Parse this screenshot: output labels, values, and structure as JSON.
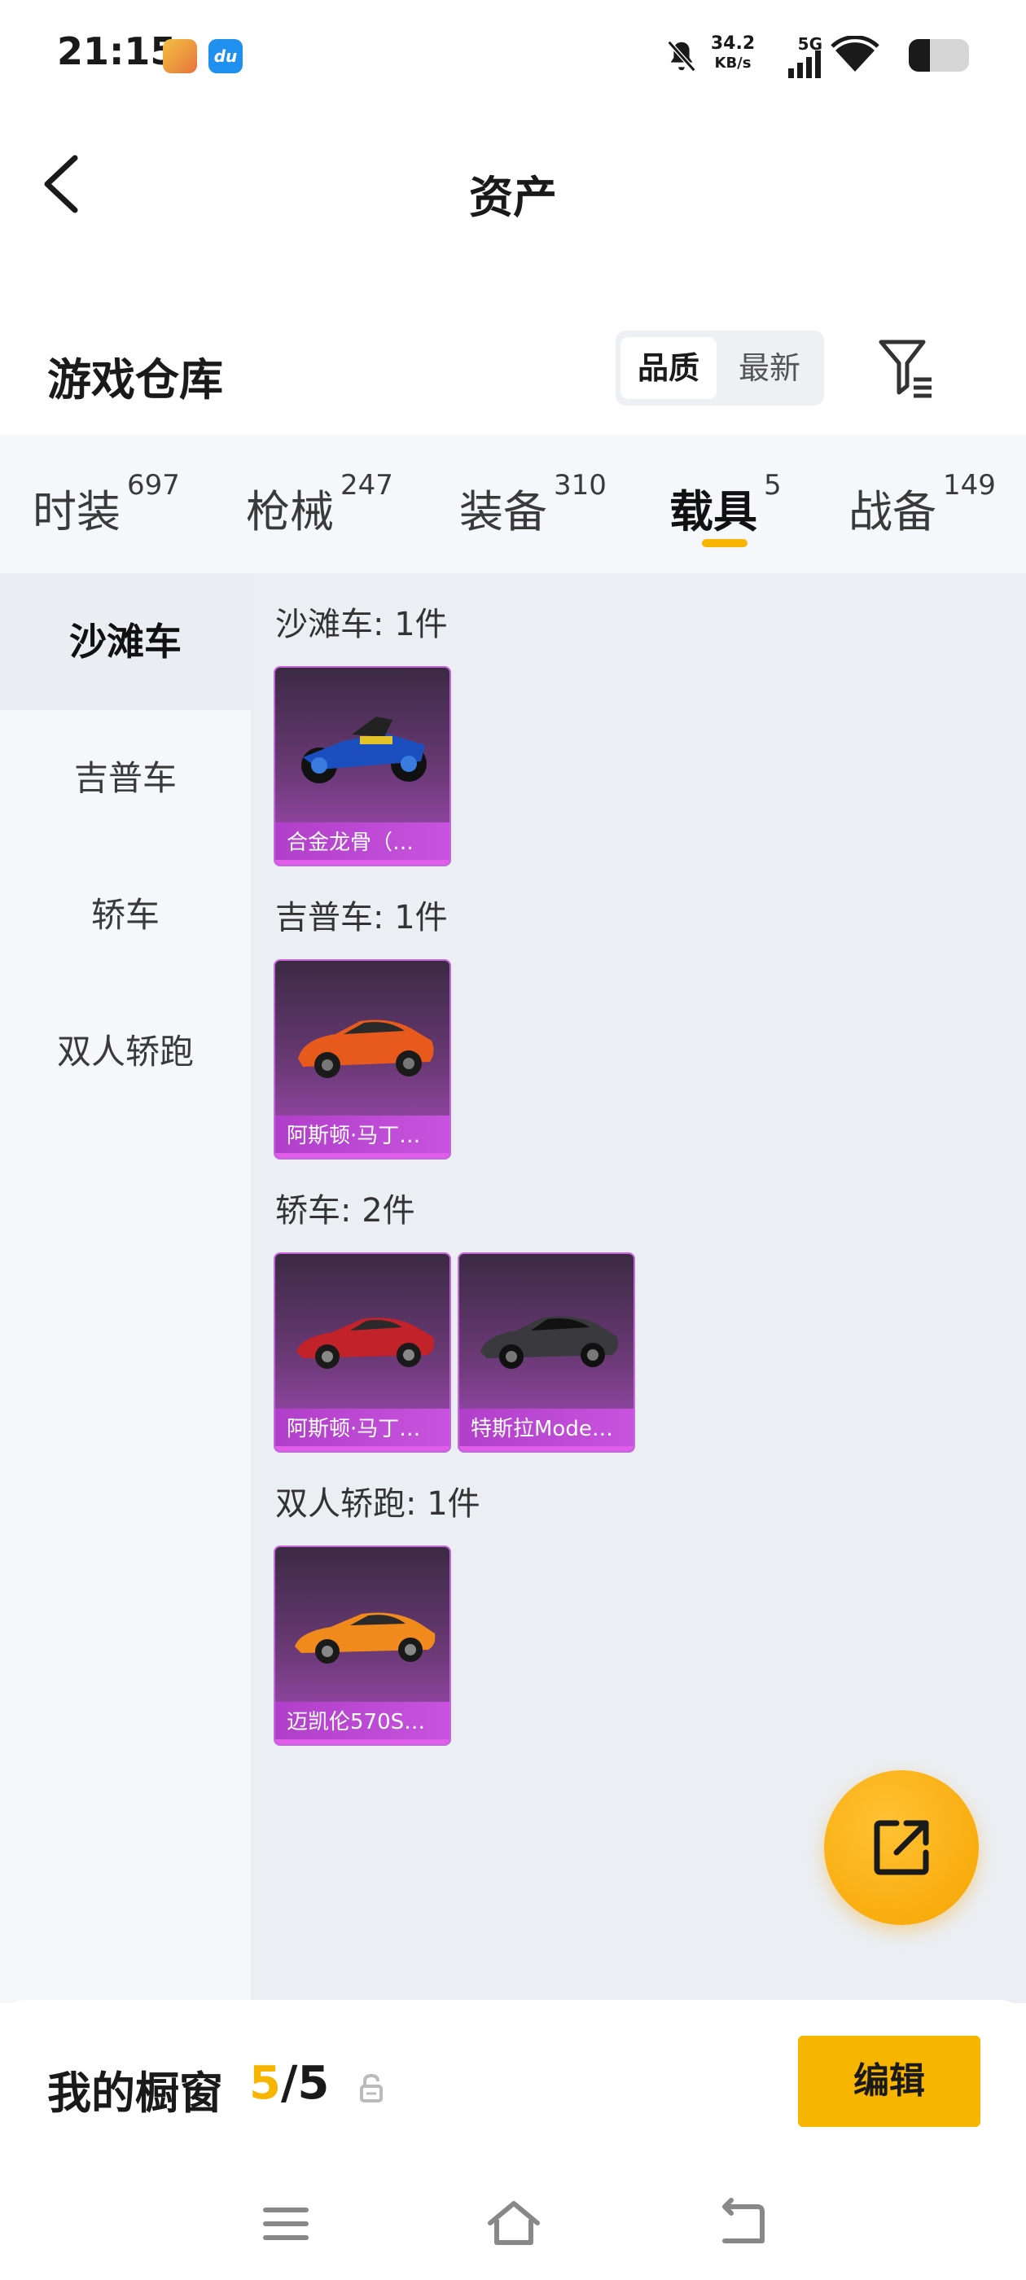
{
  "status_bar": {
    "time": "21:15",
    "net_speed_value": "34.2",
    "net_speed_unit": "KB/s",
    "network": "5G",
    "app_icon_2_text": "du",
    "battery_level": 0.35
  },
  "header": {
    "title": "资产"
  },
  "warehouse": {
    "title": "游戏仓库",
    "sort_options": [
      "品质",
      "最新"
    ],
    "sort_selected": "品质"
  },
  "tabs": [
    {
      "label": "时装",
      "count": "697"
    },
    {
      "label": "枪械",
      "count": "247"
    },
    {
      "label": "装备",
      "count": "310"
    },
    {
      "label": "载具",
      "count": "5"
    },
    {
      "label": "战备",
      "count": "149"
    }
  ],
  "active_tab": "载具",
  "sidebar": {
    "items": [
      {
        "label": "沙滩车"
      },
      {
        "label": "吉普车"
      },
      {
        "label": "轿车"
      },
      {
        "label": "双人轿跑"
      }
    ],
    "active": "沙滩车"
  },
  "sections": [
    {
      "title": "沙滩车: 1件",
      "items": [
        {
          "name": "合金龙骨（…",
          "color": "#1b4fbf"
        }
      ]
    },
    {
      "title": "吉普车: 1件",
      "items": [
        {
          "name": "阿斯顿·马丁…",
          "color": "#e85a1c"
        }
      ]
    },
    {
      "title": "轿车: 2件",
      "items": [
        {
          "name": "阿斯顿·马丁…",
          "color": "#c2222a"
        },
        {
          "name": "特斯拉Mode…",
          "color": "#3a3a3e"
        }
      ]
    },
    {
      "title": "双人轿跑: 1件",
      "items": [
        {
          "name": "迈凯伦570S…",
          "color": "#f08a1c"
        }
      ]
    }
  ],
  "showcase": {
    "title": "我的橱窗",
    "current": "5",
    "separator": "/",
    "total": "5",
    "edit_label": "编辑"
  },
  "colors": {
    "accent": "#f7b500",
    "card_border": "#c466dc"
  }
}
